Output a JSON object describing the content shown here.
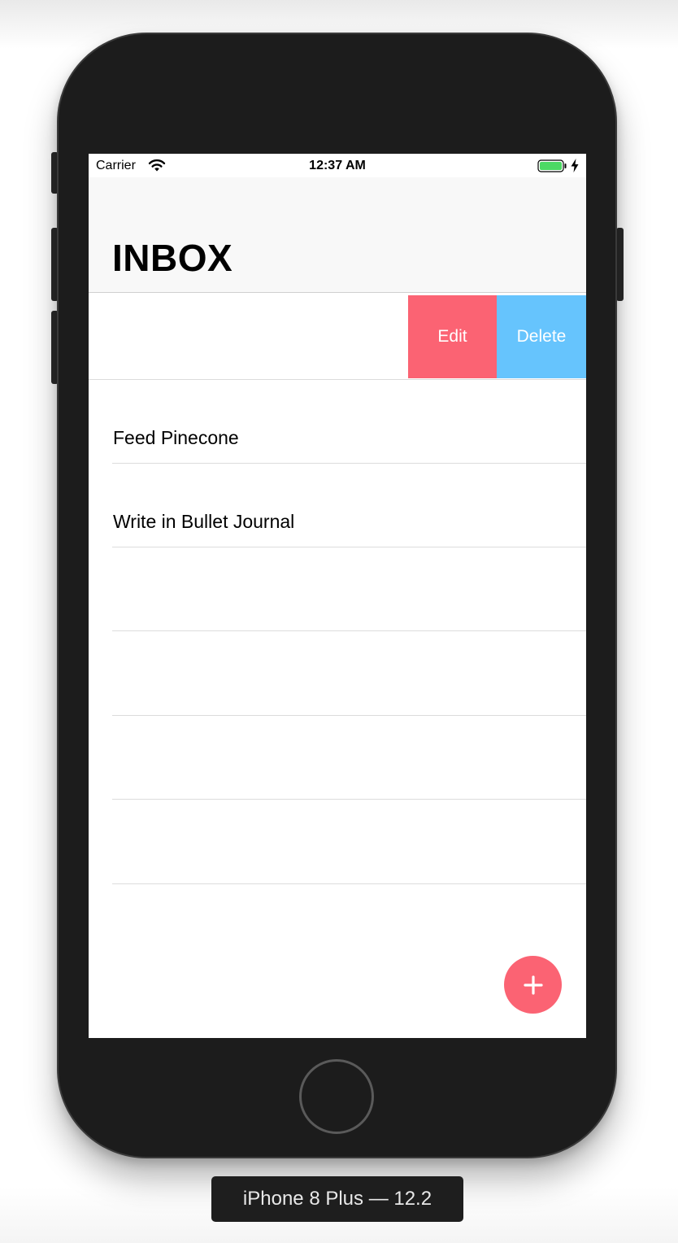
{
  "status_bar": {
    "carrier": "Carrier",
    "time": "12:37 AM",
    "wifi_icon": "wifi-icon",
    "battery_icon": "battery-full-icon",
    "battery_color": "#4cd964",
    "charging_icon": "charging-bolt-icon"
  },
  "nav": {
    "title": "INBOX"
  },
  "swipe_actions": {
    "edit_label": "Edit",
    "edit_color": "#fb6373",
    "delete_label": "Delete",
    "delete_color": "#66c4fd"
  },
  "tasks": [
    {
      "title": "Feed Pinecone"
    },
    {
      "title": "Write in Bullet Journal"
    },
    {
      "title": ""
    },
    {
      "title": ""
    },
    {
      "title": ""
    },
    {
      "title": ""
    }
  ],
  "fab": {
    "icon": "plus-icon",
    "color": "#fb6373"
  },
  "simulator": {
    "device_label": "iPhone 8 Plus — 12.2"
  }
}
